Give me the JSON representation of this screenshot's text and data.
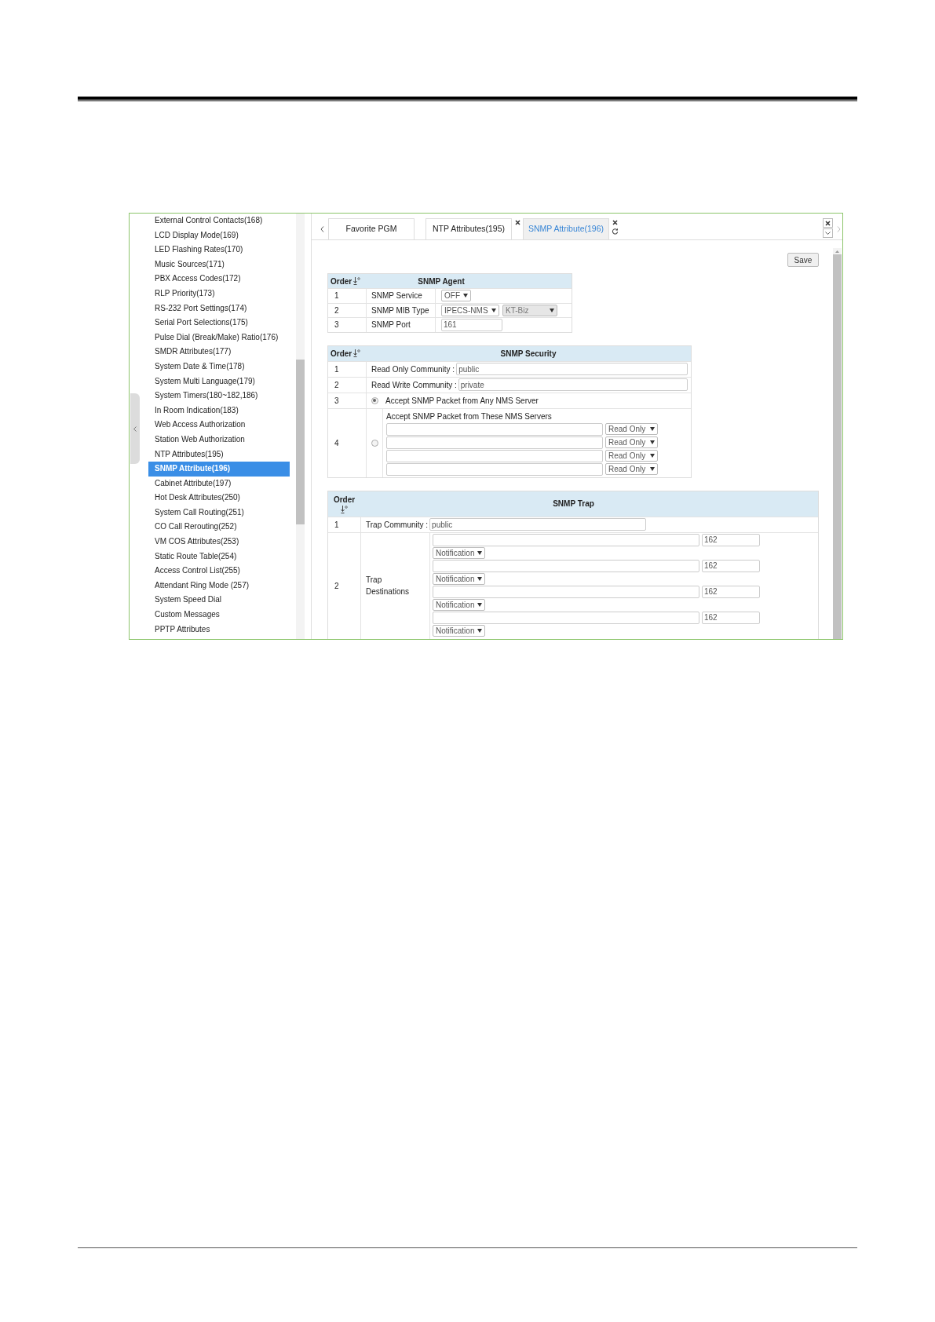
{
  "sidebar": {
    "items": [
      {
        "label": "External Control Contacts(168)",
        "selected": false
      },
      {
        "label": "LCD Display Mode(169)",
        "selected": false
      },
      {
        "label": "LED Flashing Rates(170)",
        "selected": false
      },
      {
        "label": "Music Sources(171)",
        "selected": false
      },
      {
        "label": "PBX Access Codes(172)",
        "selected": false
      },
      {
        "label": "RLP Priority(173)",
        "selected": false
      },
      {
        "label": "RS-232 Port Settings(174)",
        "selected": false
      },
      {
        "label": "Serial Port Selections(175)",
        "selected": false
      },
      {
        "label": "Pulse Dial (Break/Make) Ratio(176)",
        "selected": false
      },
      {
        "label": "SMDR Attributes(177)",
        "selected": false
      },
      {
        "label": "System Date & Time(178)",
        "selected": false
      },
      {
        "label": "System Multi Language(179)",
        "selected": false
      },
      {
        "label": "System Timers(180~182,186)",
        "selected": false
      },
      {
        "label": "In Room Indication(183)",
        "selected": false
      },
      {
        "label": "Web Access Authorization",
        "selected": false
      },
      {
        "label": "Station Web Authorization",
        "selected": false
      },
      {
        "label": "NTP Attributes(195)",
        "selected": false
      },
      {
        "label": "SNMP Attribute(196)",
        "selected": true
      },
      {
        "label": "Cabinet Attribute(197)",
        "selected": false
      },
      {
        "label": "Hot Desk Attributes(250)",
        "selected": false
      },
      {
        "label": "System Call Routing(251)",
        "selected": false
      },
      {
        "label": "CO Call Rerouting(252)",
        "selected": false
      },
      {
        "label": "VM COS Attributes(253)",
        "selected": false
      },
      {
        "label": "Static Route Table(254)",
        "selected": false
      },
      {
        "label": "Access Control List(255)",
        "selected": false
      },
      {
        "label": "Attendant Ring Mode (257)",
        "selected": false
      },
      {
        "label": "System Speed Dial",
        "selected": false
      },
      {
        "label": "Custom Messages",
        "selected": false
      },
      {
        "label": "PPTP Attributes",
        "selected": false
      }
    ]
  },
  "tabs": [
    {
      "label": "Favorite PGM",
      "selected": false,
      "closable": false
    },
    {
      "label": "NTP Attributes(195)",
      "selected": false,
      "closable": true
    },
    {
      "label": "SNMP Attribute(196)",
      "selected": true,
      "closable": true
    }
  ],
  "save_button": "Save",
  "snmp_agent": {
    "columns": [
      "Order",
      "SNMP Agent"
    ],
    "rows": [
      {
        "order": "1",
        "label": "SNMP Service",
        "controls": [
          {
            "kind": "select",
            "value": "OFF",
            "disabled": false
          }
        ]
      },
      {
        "order": "2",
        "label": "SNMP MIB Type",
        "controls": [
          {
            "kind": "select",
            "value": "IPECS-NMS",
            "disabled": false
          },
          {
            "kind": "select",
            "value": "KT-Biz",
            "disabled": true
          }
        ]
      },
      {
        "order": "3",
        "label": "SNMP Port",
        "controls": [
          {
            "kind": "input",
            "value": "161",
            "disabled": false
          }
        ]
      }
    ]
  },
  "snmp_security": {
    "columns": [
      "Order",
      "SNMP Security"
    ],
    "communities": [
      {
        "order": "1",
        "label": "Read Only Community :",
        "value": "public"
      },
      {
        "order": "2",
        "label": "Read Write Community :",
        "value": "private"
      }
    ],
    "options": [
      {
        "order": "3",
        "label": "Accept SNMP Packet from Any NMS Server",
        "selected": true
      },
      {
        "order": "4",
        "label": "Accept SNMP Packet from These NMS Servers",
        "selected": false,
        "servers": [
          {
            "access": "Read Only"
          },
          {
            "access": "Read Only"
          },
          {
            "access": "Read Only"
          },
          {
            "access": "Read Only"
          }
        ]
      }
    ]
  },
  "snmp_trap": {
    "columns": [
      "Order",
      "SNMP Trap"
    ],
    "community": {
      "order": "1",
      "label": "Trap Community :",
      "value": "public"
    },
    "destinations": {
      "order": "2",
      "label": "Trap Destinations",
      "items": [
        {
          "port": "162",
          "type": "Notification"
        },
        {
          "port": "162",
          "type": "Notification"
        },
        {
          "port": "162",
          "type": "Notification"
        },
        {
          "port": "162",
          "type": "Notification"
        }
      ]
    }
  }
}
